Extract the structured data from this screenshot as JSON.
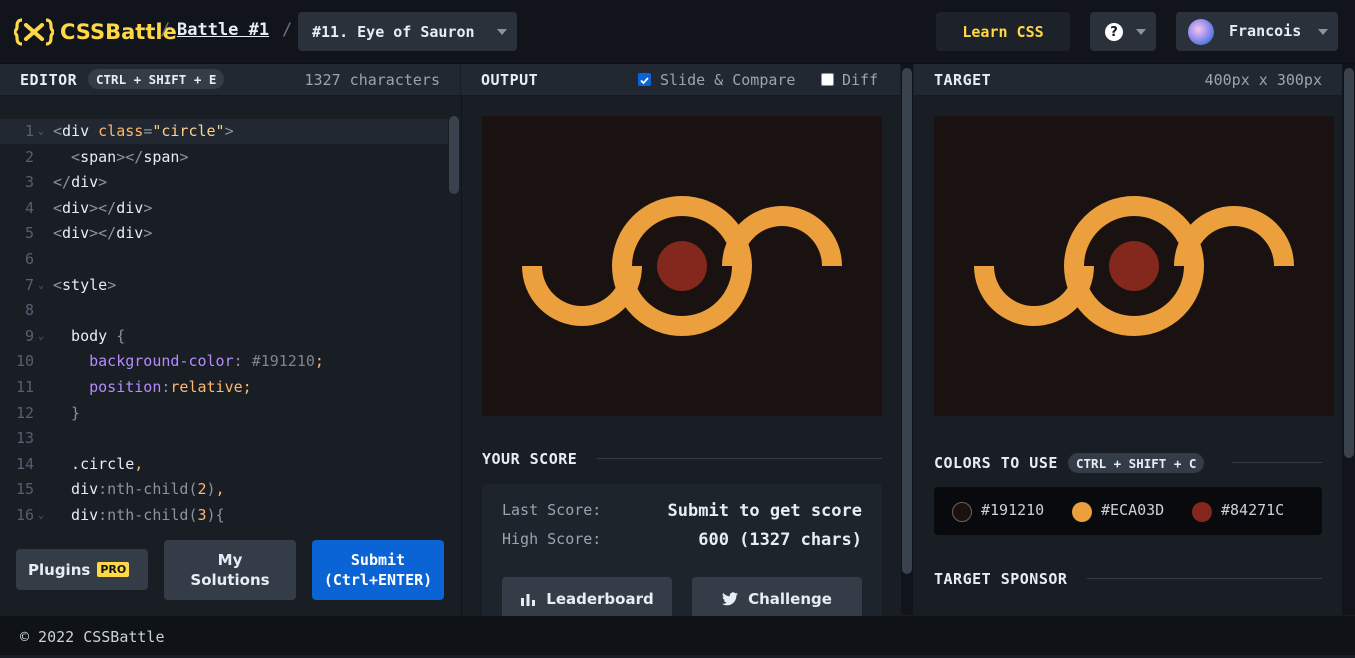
{
  "header": {
    "logo_text": "CSSBattle",
    "breadcrumb_battle": "Battle #1",
    "breadcrumb_sep": "/",
    "target_select": "#11. Eye of Sauron",
    "learn_button": "Learn CSS",
    "help_icon": "?",
    "user_name": "Francois"
  },
  "editor": {
    "title": "EDITOR",
    "shortcut": "CTRL + SHIFT + E",
    "char_count": "1327 characters",
    "lines": [
      {
        "n": "1",
        "fold": true,
        "parts": [
          {
            "t": "<",
            "c": "punc"
          },
          {
            "t": "div",
            "c": "tag"
          },
          {
            "t": " class",
            "c": "attr"
          },
          {
            "t": "=",
            "c": "punc"
          },
          {
            "t": "\"circle\"",
            "c": "str"
          },
          {
            "t": ">",
            "c": "punc"
          }
        ]
      },
      {
        "n": "2",
        "fold": false,
        "parts": [
          {
            "t": "  <",
            "c": "punc"
          },
          {
            "t": "span",
            "c": "tag"
          },
          {
            "t": "></",
            "c": "punc"
          },
          {
            "t": "span",
            "c": "tag"
          },
          {
            "t": ">",
            "c": "punc"
          }
        ]
      },
      {
        "n": "3",
        "fold": false,
        "parts": [
          {
            "t": "</",
            "c": "punc"
          },
          {
            "t": "div",
            "c": "tag"
          },
          {
            "t": ">",
            "c": "punc"
          }
        ]
      },
      {
        "n": "4",
        "fold": false,
        "parts": [
          {
            "t": "<",
            "c": "punc"
          },
          {
            "t": "div",
            "c": "tag"
          },
          {
            "t": "></",
            "c": "punc"
          },
          {
            "t": "div",
            "c": "tag"
          },
          {
            "t": ">",
            "c": "punc"
          }
        ]
      },
      {
        "n": "5",
        "fold": false,
        "parts": [
          {
            "t": "<",
            "c": "punc"
          },
          {
            "t": "div",
            "c": "tag"
          },
          {
            "t": "></",
            "c": "punc"
          },
          {
            "t": "div",
            "c": "tag"
          },
          {
            "t": ">",
            "c": "punc"
          }
        ]
      },
      {
        "n": "6",
        "fold": false,
        "parts": []
      },
      {
        "n": "7",
        "fold": true,
        "parts": [
          {
            "t": "<",
            "c": "punc"
          },
          {
            "t": "style",
            "c": "tag"
          },
          {
            "t": ">",
            "c": "punc"
          }
        ]
      },
      {
        "n": "8",
        "fold": false,
        "parts": []
      },
      {
        "n": "9",
        "fold": true,
        "parts": [
          {
            "t": "  body ",
            "c": "tag"
          },
          {
            "t": "{",
            "c": "punc"
          }
        ]
      },
      {
        "n": "10",
        "fold": false,
        "parts": [
          {
            "t": "    background-color",
            "c": "prop"
          },
          {
            "t": ": ",
            "c": "punc"
          },
          {
            "t": "#191210",
            "c": "num"
          },
          {
            "t": ";",
            "c": "semi"
          }
        ]
      },
      {
        "n": "11",
        "fold": false,
        "parts": [
          {
            "t": "    position",
            "c": "prop"
          },
          {
            "t": ":",
            "c": "punc"
          },
          {
            "t": "relative",
            "c": "val"
          },
          {
            "t": ";",
            "c": "semi"
          }
        ]
      },
      {
        "n": "12",
        "fold": false,
        "parts": [
          {
            "t": "  }",
            "c": "punc"
          }
        ]
      },
      {
        "n": "13",
        "fold": false,
        "parts": []
      },
      {
        "n": "14",
        "fold": false,
        "parts": [
          {
            "t": "  .circle",
            "c": "tag"
          },
          {
            "t": ",",
            "c": "semi"
          }
        ]
      },
      {
        "n": "15",
        "fold": false,
        "parts": [
          {
            "t": "  div",
            "c": "tag"
          },
          {
            "t": ":nth-child(",
            "c": "punc"
          },
          {
            "t": "2",
            "c": "val"
          },
          {
            "t": ")",
            "c": "punc"
          },
          {
            "t": ",",
            "c": "semi"
          }
        ]
      },
      {
        "n": "16",
        "fold": true,
        "parts": [
          {
            "t": "  div",
            "c": "tag"
          },
          {
            "t": ":nth-child(",
            "c": "punc"
          },
          {
            "t": "3",
            "c": "val"
          },
          {
            "t": "){",
            "c": "punc"
          }
        ]
      }
    ],
    "plugins_label": "Plugins",
    "pro_badge": "PRO",
    "solutions_line1": "My",
    "solutions_line2": "Solutions",
    "submit_line1": "Submit",
    "submit_line2": "(Ctrl+ENTER)"
  },
  "output": {
    "title": "OUTPUT",
    "slide_label": "Slide & Compare",
    "slide_checked": true,
    "diff_label": "Diff",
    "diff_checked": false,
    "score_title": "YOUR SCORE",
    "last_score_label": "Last Score:",
    "last_score_value": "Submit to get score",
    "high_score_label": "High Score:",
    "high_score_value": "600 (1327 chars)",
    "leaderboard_label": "Leaderboard",
    "challenge_label": "Challenge"
  },
  "target": {
    "title": "TARGET",
    "size": "400px x 300px",
    "colors_title": "COLORS TO USE",
    "colors_shortcut": "CTRL + SHIFT + C",
    "colors": [
      "#191210",
      "#ECA03D",
      "#84271C"
    ],
    "sponsor_title": "TARGET SPONSOR"
  },
  "theme": {
    "accent_blue": "#0a64d6",
    "brand_yellow": "#ffd847",
    "canvas_bg": "#191210",
    "eye_orange": "#ECA03D",
    "eye_red": "#84271C"
  },
  "footer": {
    "copyright": "© 2022 CSSBattle"
  }
}
